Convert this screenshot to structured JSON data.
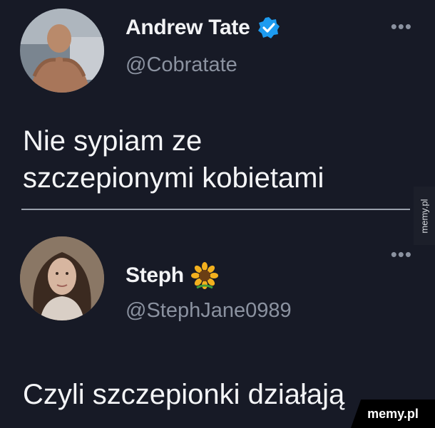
{
  "tweets": [
    {
      "author": "Andrew Tate",
      "handle": "@Cobratate",
      "verified": true,
      "badge_icon": "verified-badge-icon",
      "more_label": "•••",
      "text": "Nie sypiam ze\nszczepionymi kobietami"
    },
    {
      "author": "Steph",
      "handle": "@StephJane0989",
      "verified": false,
      "emoji_icon": "sunflower-icon",
      "more_label": "•••",
      "text": "Czyli szczepionki działają"
    }
  ],
  "watermarks": {
    "side": "memy.pl",
    "corner": "memy.pl"
  },
  "colors": {
    "background": "#171a26",
    "verified_blue": "#1d9bf0",
    "handle_gray": "#8b92a0"
  }
}
